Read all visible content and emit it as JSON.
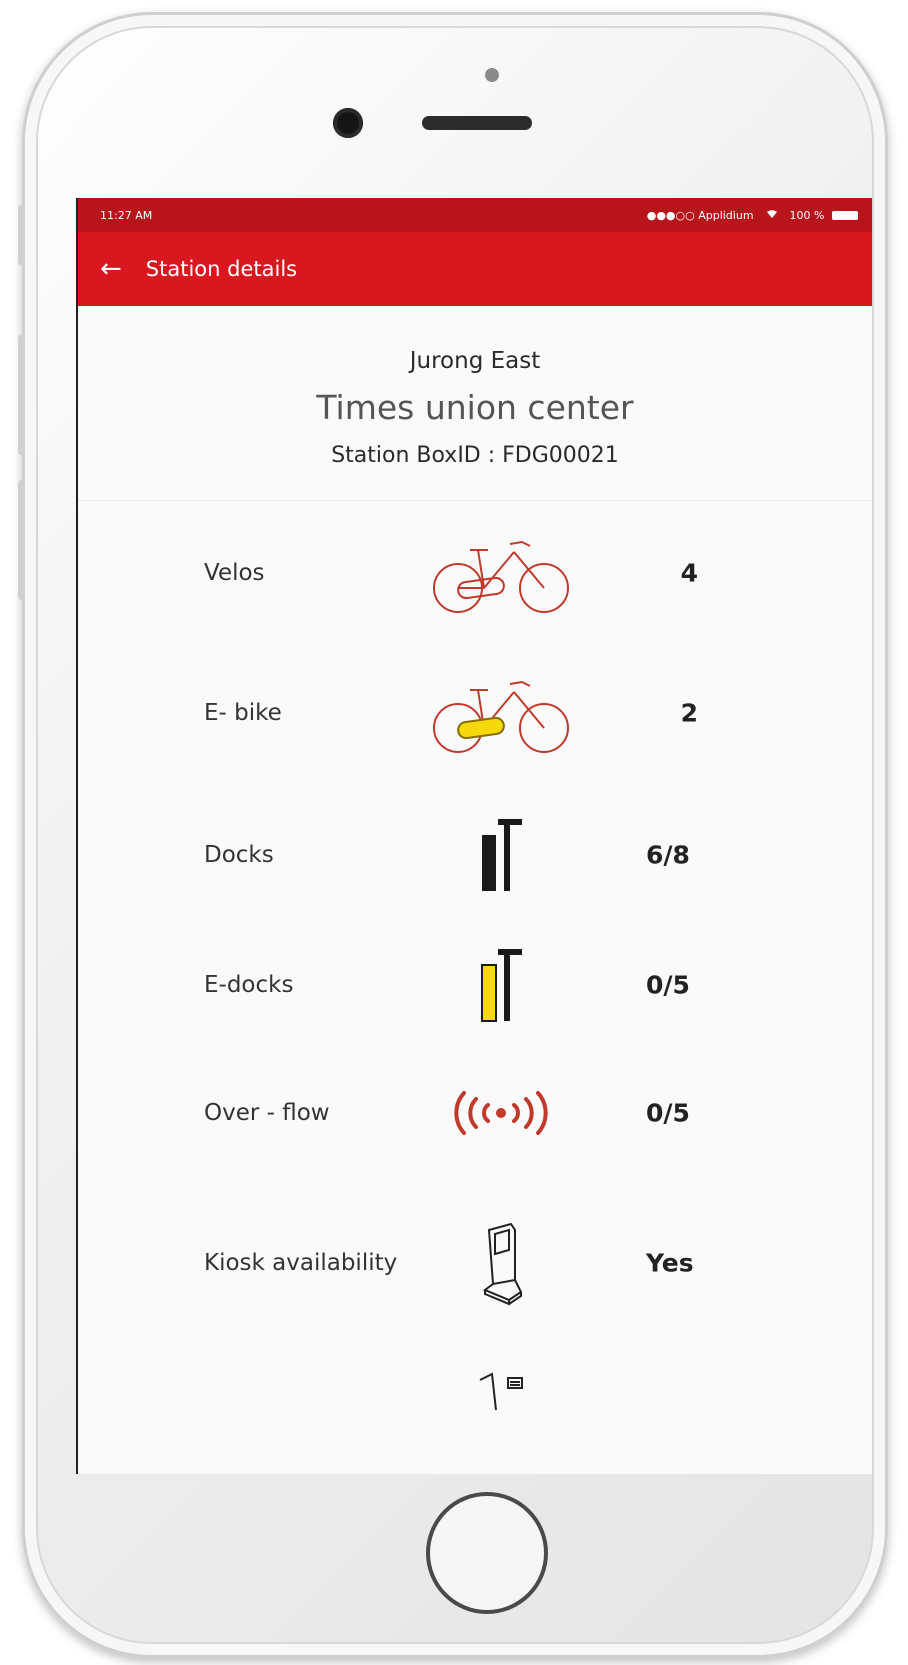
{
  "status_bar": {
    "time": "11:27 AM",
    "carrier": "●●●○○ Applidium",
    "wifi_icon": "wifi-icon",
    "battery": "100 %"
  },
  "app_bar": {
    "back_icon": "arrow-left-icon",
    "title": "Station details"
  },
  "station": {
    "area": "Jurong East",
    "name": "Times union center",
    "box_id": "Station BoxID : FDG00021"
  },
  "details": [
    {
      "label": "Velos",
      "icon": "bicycle-icon",
      "value": "4"
    },
    {
      "label": "E- bike",
      "icon": "e-bike-icon",
      "value": "2"
    },
    {
      "label": "Docks",
      "icon": "dock-icon",
      "value": "6/8"
    },
    {
      "label": "E-docks",
      "icon": "e-dock-icon",
      "value": "0/5"
    },
    {
      "label": "Over - flow",
      "icon": "overflow-signal-icon",
      "value": "0/5"
    },
    {
      "label": "Kiosk availability",
      "icon": "kiosk-icon",
      "value": "Yes"
    }
  ],
  "colors": {
    "app_bar": "#d9171f",
    "status_bar": "#b8141c",
    "bike_outline": "#c0392b",
    "battery_yellow": "#f5d90a"
  }
}
